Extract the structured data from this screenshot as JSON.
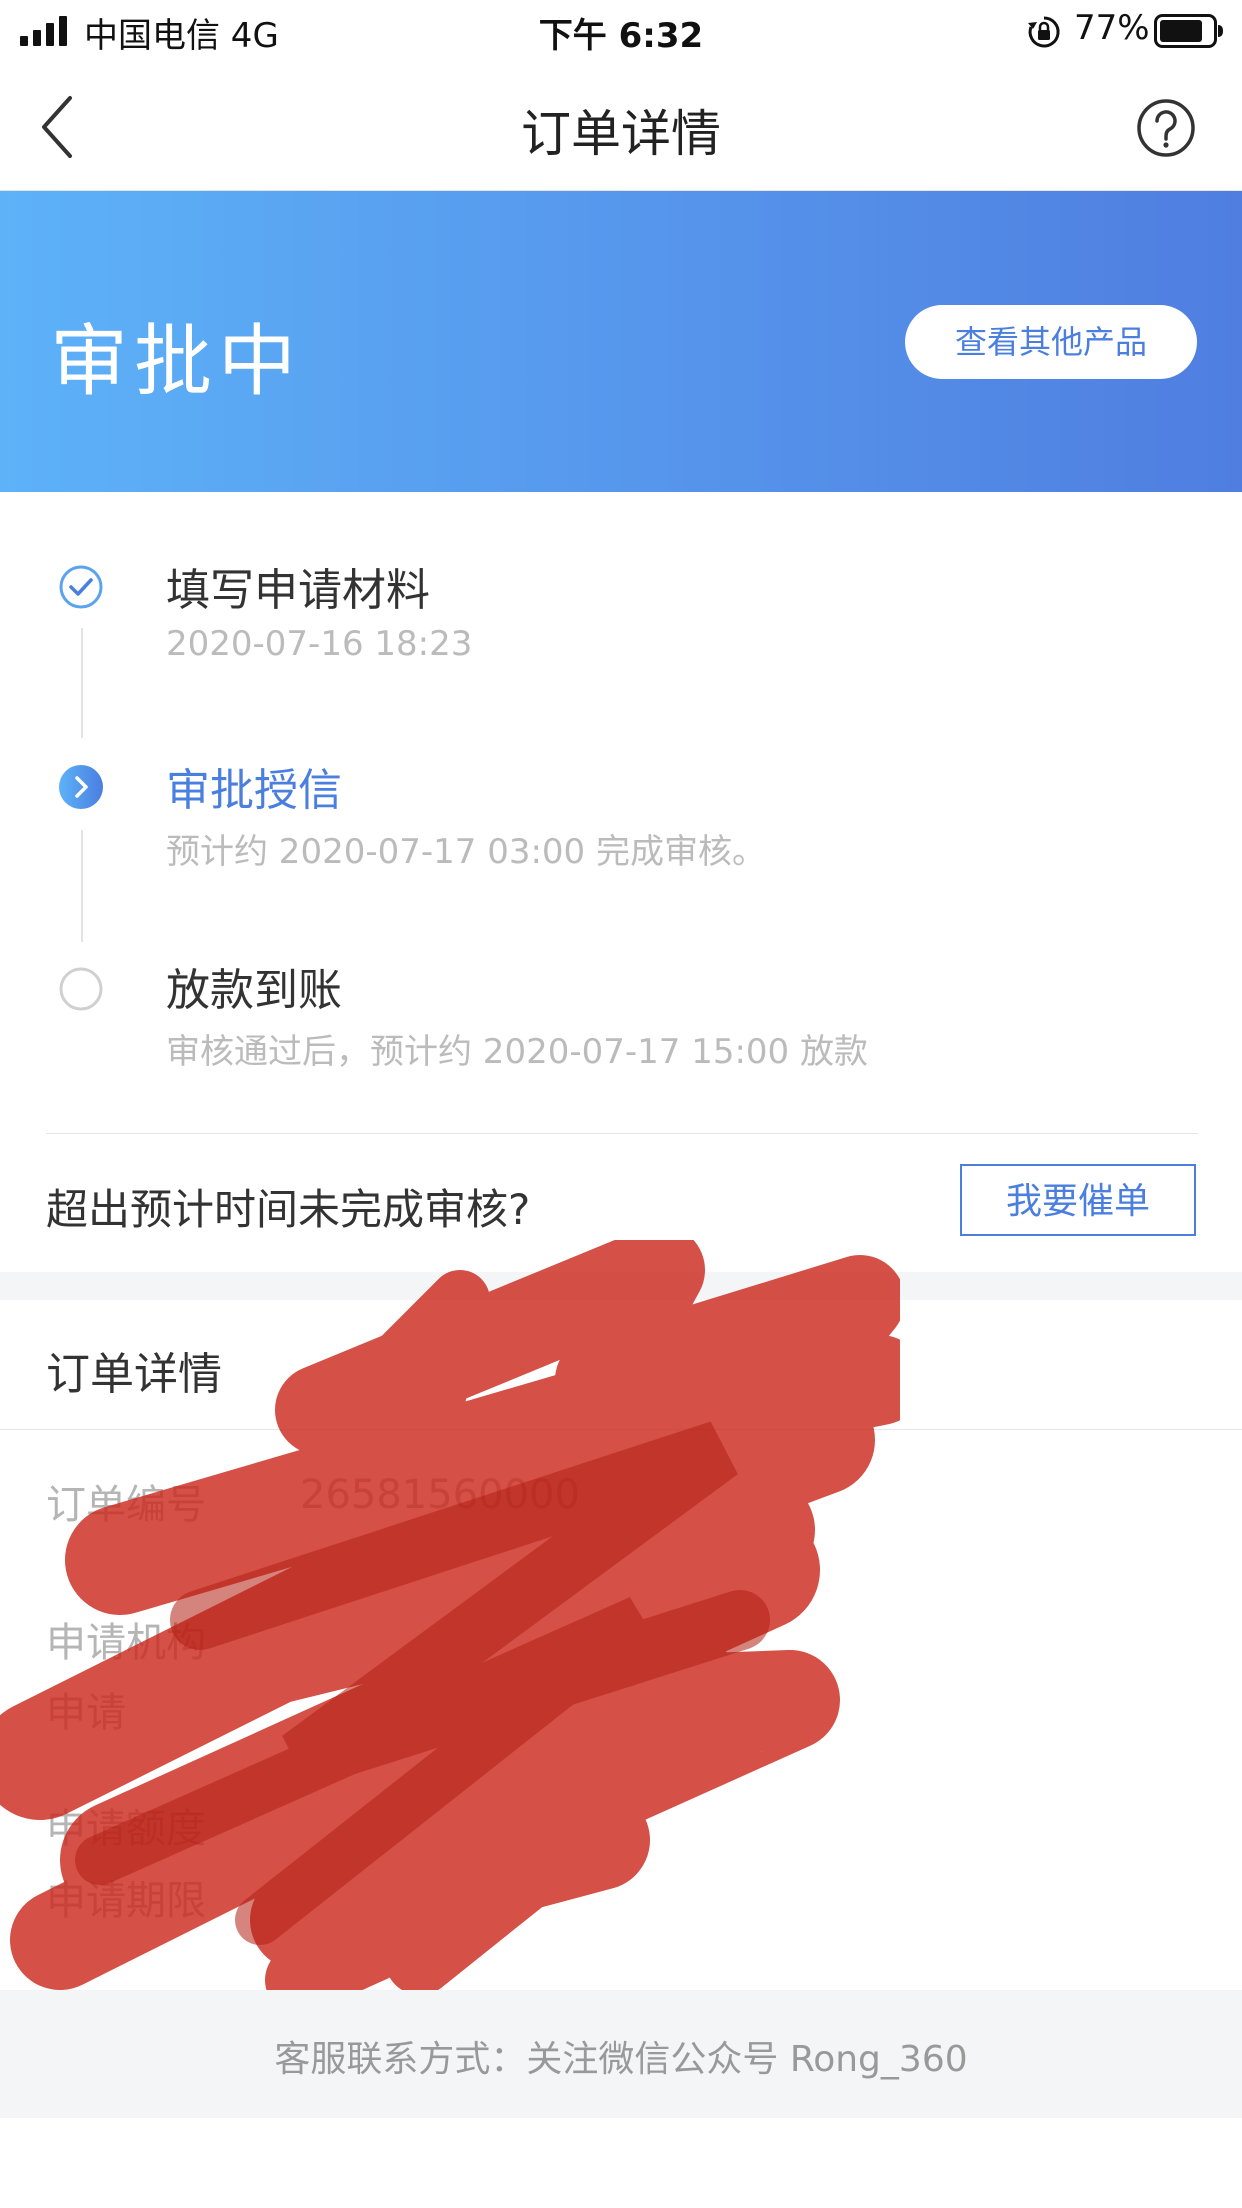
{
  "status_bar": {
    "carrier": "中国电信   4G",
    "time": "下午 6:32",
    "battery": "77%"
  },
  "nav": {
    "title": "订单详情"
  },
  "banner": {
    "status": "审批中",
    "other_products_label": "查看其他产品",
    "accent": "#4a7fe0"
  },
  "steps": [
    {
      "title": "填写申请材料",
      "subtitle": "2020-07-16 18:23",
      "state": "done"
    },
    {
      "title": "审批授信",
      "subtitle": "预计约 2020-07-17 03:00 完成审核。",
      "state": "active"
    },
    {
      "title": "放款到账",
      "subtitle": "审核通过后，预计约 2020-07-17 15:00 放款",
      "state": "pending"
    }
  ],
  "overdue": {
    "question": "超出预计时间未完成审核?",
    "urge_label": "我要催单"
  },
  "details": {
    "title": "订单详情",
    "order_no_label": "订单编号",
    "order_no_value": "26581560000",
    "institution_label": "申请机构",
    "time_label": "申请",
    "amount_label": "申请额度",
    "period_label": "申请期限"
  },
  "footer": {
    "contact": "客服联系方式：关注微信公众号 Rong_360"
  }
}
